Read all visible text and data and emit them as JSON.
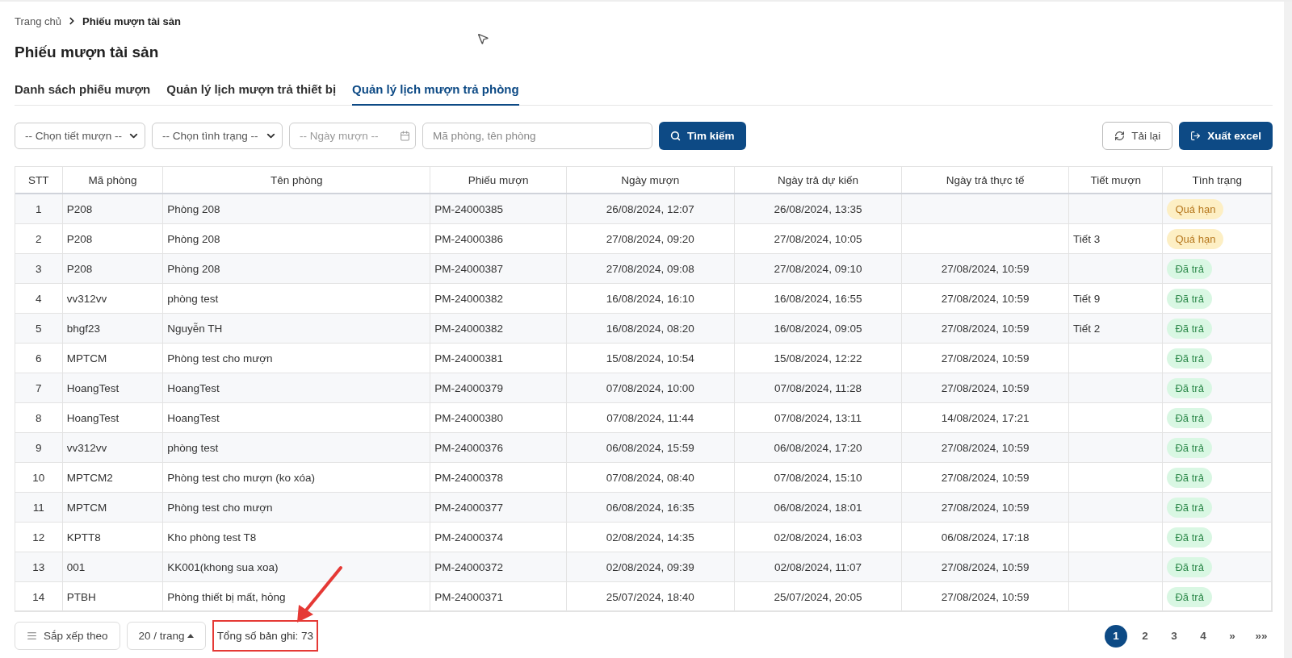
{
  "breadcrumb": [
    {
      "label": "Trang chủ",
      "current": false
    },
    {
      "label": "Phiếu mượn tài sản",
      "current": true
    }
  ],
  "page_title": "Phiếu mượn tài sản",
  "tabs": [
    {
      "label": "Danh sách phiếu mượn",
      "selected": false
    },
    {
      "label": "Quản lý lịch mượn trả thiết bị",
      "selected": false
    },
    {
      "label": "Quản lý lịch mượn trả phòng",
      "selected": true
    }
  ],
  "filters": {
    "period_select": "-- Chọn tiết mượn --",
    "status_select": "-- Chọn tình trạng --",
    "date_placeholder": "-- Ngày mượn --",
    "search_placeholder": "Mã phòng, tên phòng",
    "search_button": "Tìm kiếm",
    "reload_button": "Tải lại",
    "export_button": "Xuất excel"
  },
  "table": {
    "columns": [
      "STT",
      "Mã phòng",
      "Tên phòng",
      "Phiếu mượn",
      "Ngày mượn",
      "Ngày trả dự kiến",
      "Ngày trả thực tế",
      "Tiết mượn",
      "Tình trạng"
    ],
    "rows": [
      {
        "stt": "1",
        "room_code": "P208",
        "room_name": "Phòng 208",
        "slip": "PM-24000385",
        "borrow_date": "26/08/2024, 12:07",
        "due_date": "26/08/2024, 13:35",
        "status": {
          "label": "Quá hạn",
          "kind": "overdue"
        }
      },
      {
        "stt": "2",
        "room_code": "P208",
        "room_name": "Phòng 208",
        "slip": "PM-24000386",
        "borrow_date": "27/08/2024, 09:20",
        "due_date": "27/08/2024, 10:05",
        "period": "Tiết 3",
        "status": {
          "label": "Quá hạn",
          "kind": "overdue"
        }
      },
      {
        "stt": "3",
        "room_code": "P208",
        "room_name": "Phòng 208",
        "slip": "PM-24000387",
        "borrow_date": "27/08/2024, 09:08",
        "due_date": "27/08/2024, 09:10",
        "returned_date": "27/08/2024, 10:59",
        "status": {
          "label": "Đã trả",
          "kind": "returned"
        }
      },
      {
        "stt": "4",
        "room_code": "vv312vv",
        "room_name": "phòng test",
        "slip": "PM-24000382",
        "borrow_date": "16/08/2024, 16:10",
        "due_date": "16/08/2024, 16:55",
        "returned_date": "27/08/2024, 10:59",
        "period": "Tiết 9",
        "status": {
          "label": "Đã trả",
          "kind": "returned"
        }
      },
      {
        "stt": "5",
        "room_code": "bhgf23",
        "room_name": "Nguyễn TH",
        "slip": "PM-24000382",
        "borrow_date": "16/08/2024, 08:20",
        "due_date": "16/08/2024, 09:05",
        "returned_date": "27/08/2024, 10:59",
        "period": "Tiết 2",
        "status": {
          "label": "Đã trả",
          "kind": "returned"
        }
      },
      {
        "stt": "6",
        "room_code": "MPTCM",
        "room_name": "Phòng test cho mượn",
        "slip": "PM-24000381",
        "borrow_date": "15/08/2024, 10:54",
        "due_date": "15/08/2024, 12:22",
        "returned_date": "27/08/2024, 10:59",
        "status": {
          "label": "Đã trả",
          "kind": "returned"
        }
      },
      {
        "stt": "7",
        "room_code": "HoangTest",
        "room_name": "HoangTest",
        "slip": "PM-24000379",
        "borrow_date": "07/08/2024, 10:00",
        "due_date": "07/08/2024, 11:28",
        "returned_date": "27/08/2024, 10:59",
        "status": {
          "label": "Đã trả",
          "kind": "returned"
        }
      },
      {
        "stt": "8",
        "room_code": "HoangTest",
        "room_name": "HoangTest",
        "slip": "PM-24000380",
        "borrow_date": "07/08/2024, 11:44",
        "due_date": "07/08/2024, 13:11",
        "returned_date": "14/08/2024, 17:21",
        "status": {
          "label": "Đã trả",
          "kind": "returned"
        }
      },
      {
        "stt": "9",
        "room_code": "vv312vv",
        "room_name": "phòng test",
        "slip": "PM-24000376",
        "borrow_date": "06/08/2024, 15:59",
        "due_date": "06/08/2024, 17:20",
        "returned_date": "27/08/2024, 10:59",
        "status": {
          "label": "Đã trả",
          "kind": "returned"
        }
      },
      {
        "stt": "10",
        "room_code": "MPTCM2",
        "room_name": "Phòng test cho mượn (ko xóa)",
        "slip": "PM-24000378",
        "borrow_date": "07/08/2024, 08:40",
        "due_date": "07/08/2024, 15:10",
        "returned_date": "27/08/2024, 10:59",
        "status": {
          "label": "Đã trả",
          "kind": "returned"
        }
      },
      {
        "stt": "11",
        "room_code": "MPTCM",
        "room_name": "Phòng test cho mượn",
        "slip": "PM-24000377",
        "borrow_date": "06/08/2024, 16:35",
        "due_date": "06/08/2024, 18:01",
        "returned_date": "27/08/2024, 10:59",
        "status": {
          "label": "Đã trả",
          "kind": "returned"
        }
      },
      {
        "stt": "12",
        "room_code": "KPTT8",
        "room_name": "Kho phòng test T8",
        "slip": "PM-24000374",
        "borrow_date": "02/08/2024, 14:35",
        "due_date": "02/08/2024, 16:03",
        "returned_date": "06/08/2024, 17:18",
        "status": {
          "label": "Đã trả",
          "kind": "returned"
        }
      },
      {
        "stt": "13",
        "room_code": "001",
        "room_name": "KK001(khong sua xoa)",
        "slip": "PM-24000372",
        "borrow_date": "02/08/2024, 09:39",
        "due_date": "02/08/2024, 11:07",
        "returned_date": "27/08/2024, 10:59",
        "status": {
          "label": "Đã trả",
          "kind": "returned"
        }
      },
      {
        "stt": "14",
        "room_code": "PTBH",
        "room_name": "Phòng thiết bị mất, hỏng",
        "slip": "PM-24000371",
        "borrow_date": "25/07/2024, 18:40",
        "due_date": "25/07/2024, 20:05",
        "returned_date": "27/08/2024, 10:59",
        "status": {
          "label": "Đã trả",
          "kind": "returned"
        }
      }
    ]
  },
  "footer": {
    "sort_button": "Sắp xếp theo",
    "page_size": "20 / trang",
    "total": "Tổng số bản ghi: 73"
  },
  "pagination": {
    "pages": [
      {
        "label": "1",
        "selected": true
      },
      {
        "label": "2",
        "selected": false
      },
      {
        "label": "3",
        "selected": false
      },
      {
        "label": "4",
        "selected": false
      }
    ],
    "next": "»",
    "last": "»»"
  }
}
